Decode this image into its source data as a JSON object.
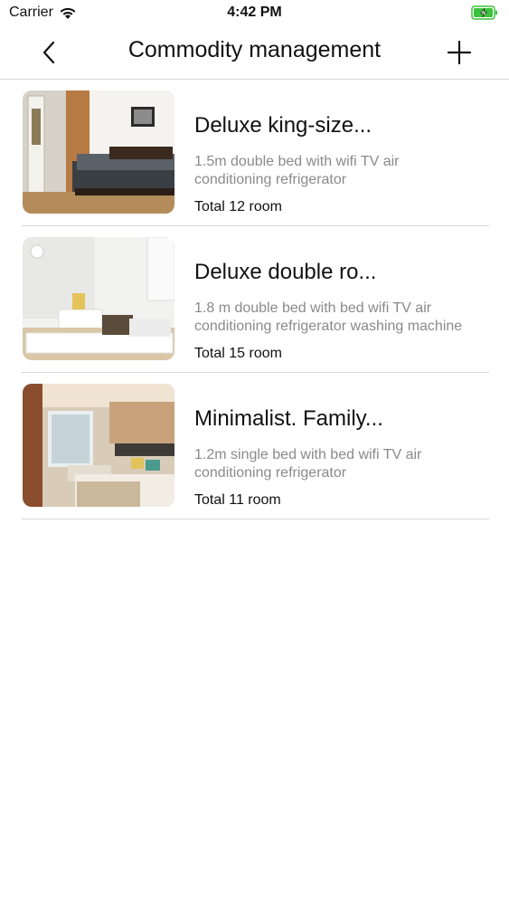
{
  "status_bar": {
    "carrier": "Carrier",
    "time": "4:42 PM",
    "battery_color": "#3cc23c"
  },
  "nav": {
    "title": "Commodity management",
    "back_icon": "chevron-left-icon",
    "add_icon": "plus-icon"
  },
  "rooms": [
    {
      "title": "Deluxe king-size...",
      "description": "1.5m double bed with wifi TV air conditioning refrigerator",
      "count": "Total 12 room"
    },
    {
      "title": "Deluxe double ro...",
      "description": "1.8 m double bed with bed wifi TV air conditioning refrigerator washing machine",
      "count": "Total 15 room"
    },
    {
      "title": "Minimalist. Family...",
      "description": "1.2m single bed with bed wifi TV air conditioning refrigerator",
      "count": "Total 11 room"
    }
  ]
}
